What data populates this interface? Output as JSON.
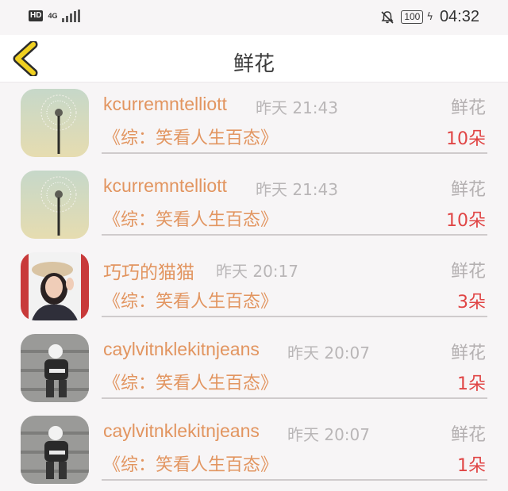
{
  "status_bar": {
    "hd_label": "HD",
    "network_label": "4G",
    "battery_level": "100",
    "time": "04:32",
    "icons": [
      "signal-icon",
      "mute-bell-icon",
      "battery-icon",
      "charging-icon"
    ]
  },
  "header": {
    "back_icon": "back-chevron-icon",
    "title": "鲜花"
  },
  "colors": {
    "accent": "#e29560",
    "count": "#e04545",
    "back_chevron": "#f0d021",
    "muted": "#b9b6b7"
  },
  "gift_list": [
    {
      "username": "kcurremntelliott",
      "time": "昨天 21:43",
      "gift_type": "鲜花",
      "book_title": "《综：笑看人生百态》",
      "count": "10朵",
      "avatar": "dandelion"
    },
    {
      "username": "kcurremntelliott",
      "time": "昨天 21:43",
      "gift_type": "鲜花",
      "book_title": "《综：笑看人生百态》",
      "count": "10朵",
      "avatar": "dandelion"
    },
    {
      "username": "巧巧的猫猫",
      "time": "昨天 20:17",
      "gift_type": "鲜花",
      "book_title": "《综：笑看人生百态》",
      "count": "3朵",
      "avatar": "woman-hat"
    },
    {
      "username": "caylvitnklekitnjeans",
      "time": "昨天 20:07",
      "gift_type": "鲜花",
      "book_title": "《综：笑看人生百态》",
      "count": "1朵",
      "avatar": "figure-stairs"
    },
    {
      "username": "caylvitnklekitnjeans",
      "time": "昨天 20:07",
      "gift_type": "鲜花",
      "book_title": "《综：笑看人生百态》",
      "count": "1朵",
      "avatar": "figure-stairs"
    }
  ]
}
